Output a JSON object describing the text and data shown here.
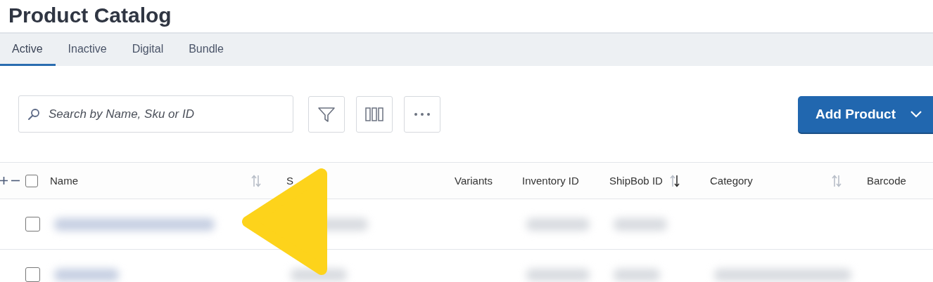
{
  "page": {
    "title": "Product Catalog"
  },
  "tabs": [
    {
      "label": "Active",
      "selected": true
    },
    {
      "label": "Inactive",
      "selected": false
    },
    {
      "label": "Digital",
      "selected": false
    },
    {
      "label": "Bundle",
      "selected": false
    }
  ],
  "toolbar": {
    "search": {
      "placeholder": "Search by Name, Sku or ID"
    },
    "add_button": "Add Product"
  },
  "table": {
    "header_checked": false,
    "columns": [
      {
        "label": "Name",
        "sorted": false
      },
      {
        "label": "S"
      },
      {
        "label": "Variants"
      },
      {
        "label": "Inventory ID"
      },
      {
        "label": "ShipBob ID",
        "sorted": true
      },
      {
        "label": "Category",
        "sorted": false
      },
      {
        "label": "Barcode"
      }
    ],
    "rows": [
      {
        "checked": false
      },
      {
        "checked": false
      }
    ]
  }
}
